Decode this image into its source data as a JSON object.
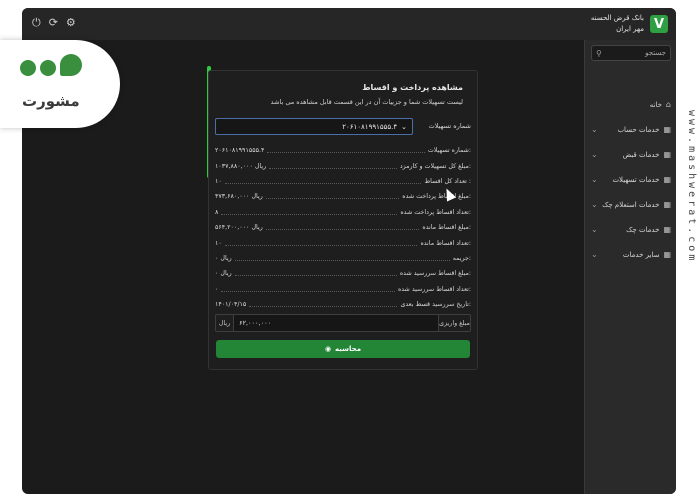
{
  "overlay": {
    "brand_logo_text": "مشورت"
  },
  "watermark": {
    "text": "www.mashwerat.com"
  },
  "window": {
    "bank_name_line1": "بانک قرض الحسنه",
    "bank_name_line2": "مهر ایران",
    "brand_mark": "V",
    "top_icons": [
      "⏻",
      "⟳",
      "⚙"
    ]
  },
  "sidebar": {
    "search_placeholder": "جستجو",
    "items": [
      {
        "label": "خانه",
        "chevron": ""
      },
      {
        "label": "خدمات حساب",
        "chevron": "⌄"
      },
      {
        "label": "خدمات قبض",
        "chevron": "⌄"
      },
      {
        "label": "خدمات تسهیلات",
        "chevron": "⌄"
      },
      {
        "label": "خدمات استعلام چک",
        "chevron": "⌄"
      },
      {
        "label": "خدمات چک",
        "chevron": "⌄"
      },
      {
        "label": "سایر خدمات",
        "chevron": "⌄"
      }
    ]
  },
  "form": {
    "title": "مشاهده پرداخت و اقساط",
    "subtitle": "لیست تسهیلات شما و جزییات آن در این قسمت قابل مشاهده می باشد",
    "facility_label": "شماره تسهیلات",
    "facility_value": "۲۰۶۱۰۸۱۹۹۱۵۵۵.۴",
    "rows": [
      {
        "label": "شماره تسهیلات:",
        "value": "۲۰۶۱۰۸۱۹۹۱۵۵۵.۴"
      },
      {
        "label": "مبلغ کل تسهیلات و کارمزد:",
        "value": "۱۰۳۷,۸۸۰,۰۰۰ ریال"
      },
      {
        "label": "تعداد کل اقساط :",
        "value": "۱۰"
      },
      {
        "label": "مبلغ اقساط پرداخت شده:",
        "value": "۴۷۳,۶۸۰,۰۰۰ ریال"
      },
      {
        "label": "تعداد اقساط پرداخت شده:",
        "value": "۸"
      },
      {
        "label": "مبلغ اقساط مانده:",
        "value": "۵۶۴,۲۰۰,۰۰۰ ریال"
      },
      {
        "label": "تعداد اقساط مانده:",
        "value": "۱۰"
      },
      {
        "label": "جریمه:",
        "value": "۰ ریال"
      },
      {
        "label": "مبلغ اقساط سررسید شده:",
        "value": "۰ ریال"
      },
      {
        "label": "تعداد اقساط سررسید شده:",
        "value": "۰"
      },
      {
        "label": "تاریخ سررسید قسط بعدی:",
        "value": "۱۴۰۱/۰۴/۱۵"
      }
    ],
    "amount_label": "مبلغ واریزی",
    "amount_value": "۶۲,۰۰۰,۰۰۰",
    "amount_unit": "ریال",
    "calc_button": "محاسبه"
  }
}
